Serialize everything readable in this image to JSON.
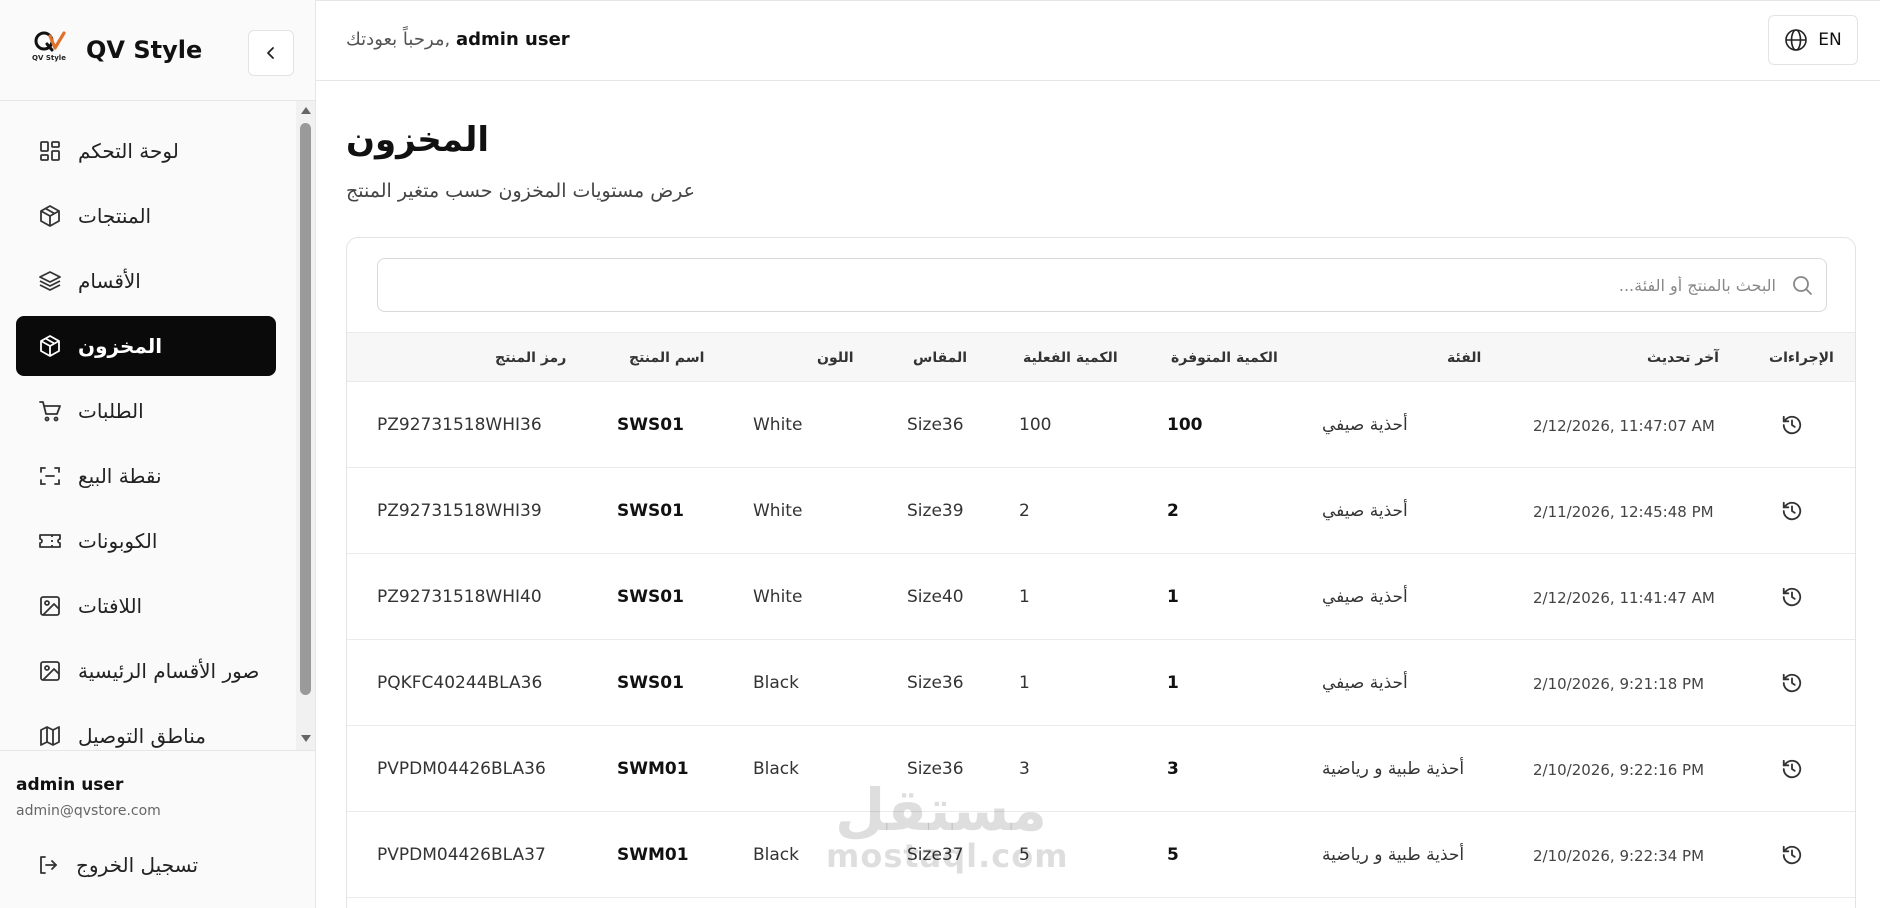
{
  "brand": {
    "name": "QV Style",
    "logo_text": "QV Style"
  },
  "sidebar": {
    "items": [
      {
        "label": "لوحة التحكم",
        "icon": "dashboard-icon"
      },
      {
        "label": "المنتجات",
        "icon": "box-icon"
      },
      {
        "label": "الأقسام",
        "icon": "layers-icon"
      },
      {
        "label": "المخزون",
        "icon": "package-icon",
        "active": true
      },
      {
        "label": "الطلبات",
        "icon": "cart-icon"
      },
      {
        "label": "نقطة البيع",
        "icon": "scan-icon"
      },
      {
        "label": "الكوبونات",
        "icon": "ticket-icon"
      },
      {
        "label": "اللافتات",
        "icon": "image-icon"
      },
      {
        "label": "صور الأقسام الرئيسية",
        "icon": "image-icon"
      },
      {
        "label": "مناطق التوصيل",
        "icon": "map-icon"
      }
    ]
  },
  "user": {
    "name": "admin user",
    "email": "admin@qvstore.com",
    "logout_label": "تسجيل الخروج"
  },
  "header": {
    "welcome_prefix": "مرحباً بعودتك,",
    "welcome_user": "admin user",
    "lang_label": "EN"
  },
  "page": {
    "title": "المخزون",
    "subtitle": "عرض مستويات المخزون حسب متغير المنتج"
  },
  "search": {
    "placeholder": "البحث بالمنتج أو الفئة..."
  },
  "table": {
    "columns": {
      "sku": "رمز المنتج",
      "name": "اسم المنتج",
      "color": "اللون",
      "size": "المقاس",
      "actual_qty": "الكمية الفعلية",
      "available_qty": "الكمية المتوفرة",
      "category": "الفئة",
      "updated": "آخر تحديث",
      "actions": "الإجراءات"
    },
    "rows": [
      {
        "sku": "PZ92731518WHI36",
        "name": "SWS01",
        "color": "White",
        "size": "Size36",
        "actual_qty": "100",
        "available_qty": "100",
        "category": "أحذية صيفي",
        "updated": "2/12/2026, 11:47:07 AM"
      },
      {
        "sku": "PZ92731518WHI39",
        "name": "SWS01",
        "color": "White",
        "size": "Size39",
        "actual_qty": "2",
        "available_qty": "2",
        "category": "أحذية صيفي",
        "updated": "2/11/2026, 12:45:48 PM"
      },
      {
        "sku": "PZ92731518WHI40",
        "name": "SWS01",
        "color": "White",
        "size": "Size40",
        "actual_qty": "1",
        "available_qty": "1",
        "category": "أحذية صيفي",
        "updated": "2/12/2026, 11:41:47 AM"
      },
      {
        "sku": "PQKFC40244BLA36",
        "name": "SWS01",
        "color": "Black",
        "size": "Size36",
        "actual_qty": "1",
        "available_qty": "1",
        "category": "أحذية صيفي",
        "updated": "2/10/2026, 9:21:18 PM"
      },
      {
        "sku": "PVPDM04426BLA36",
        "name": "SWM01",
        "color": "Black",
        "size": "Size36",
        "actual_qty": "3",
        "available_qty": "3",
        "category": "أحذية طبية و رياضية",
        "updated": "2/10/2026, 9:22:16 PM"
      },
      {
        "sku": "PVPDM04426BLA37",
        "name": "SWM01",
        "color": "Black",
        "size": "Size37",
        "actual_qty": "5",
        "available_qty": "5",
        "category": "أحذية طبية و رياضية",
        "updated": "2/10/2026, 9:22:34 PM"
      }
    ]
  },
  "watermark": {
    "arabic": "مستقل",
    "latin": "mostaql.com"
  },
  "colors": {
    "active_bg": "#0a0a0a",
    "logo_accent": "#e0712b"
  }
}
